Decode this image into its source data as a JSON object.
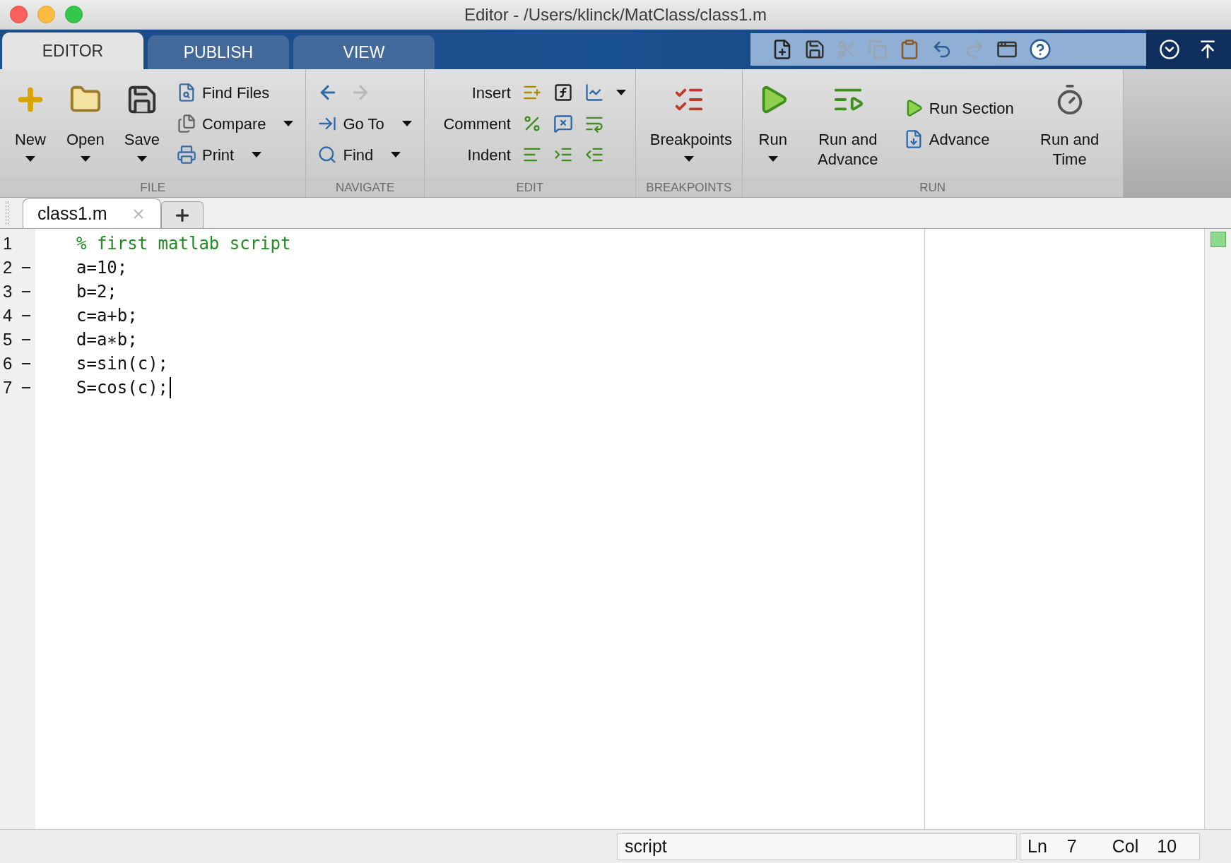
{
  "window": {
    "title": "Editor - /Users/klinck/MatClass/class1.m"
  },
  "ribbon": {
    "tabs": [
      {
        "label": "EDITOR",
        "selected": true
      },
      {
        "label": "PUBLISH",
        "selected": false
      },
      {
        "label": "VIEW",
        "selected": false
      }
    ],
    "groups": [
      {
        "label": "FILE",
        "buttons": [
          {
            "kind": "large",
            "label": "New",
            "menu": true
          },
          {
            "kind": "large",
            "label": "Open",
            "menu": true
          },
          {
            "kind": "large",
            "label": "Save",
            "menu": true
          },
          {
            "kind": "small",
            "label": "Find Files",
            "menu": false
          },
          {
            "kind": "small",
            "label": "Compare",
            "menu": true
          },
          {
            "kind": "small",
            "label": "Print",
            "menu": true
          }
        ]
      },
      {
        "label": "NAVIGATE",
        "buttons": [
          {
            "kind": "arrows"
          },
          {
            "kind": "small",
            "label": "Go To",
            "menu": true
          },
          {
            "kind": "small",
            "label": "Find",
            "menu": true
          }
        ]
      },
      {
        "label": "EDIT",
        "buttons": [
          {
            "kind": "row",
            "label": "Insert",
            "menu": true
          },
          {
            "kind": "row",
            "label": "Comment",
            "menu": false
          },
          {
            "kind": "row",
            "label": "Indent",
            "menu": false
          }
        ]
      },
      {
        "label": "BREAKPOINTS",
        "buttons": [
          {
            "kind": "large",
            "label": "Breakpoints",
            "menu": true
          }
        ]
      },
      {
        "label": "RUN",
        "buttons": [
          {
            "kind": "large",
            "label": "Run",
            "menu": true
          },
          {
            "kind": "large",
            "label": "Run and Advance",
            "menu": false
          },
          {
            "kind": "small",
            "label": "Run Section",
            "menu": false
          },
          {
            "kind": "small",
            "label": "Advance",
            "menu": false
          },
          {
            "kind": "large",
            "label": "Run and Time",
            "menu": false
          }
        ]
      }
    ]
  },
  "documents": [
    {
      "label": "class1.m",
      "selected": true
    }
  ],
  "editor": {
    "lines": [
      {
        "number": "1",
        "text": "% first matlab script",
        "kind": "comment",
        "executable": false,
        "cursor": false
      },
      {
        "number": "2",
        "text": "a=10;",
        "kind": "code",
        "executable": true,
        "cursor": false
      },
      {
        "number": "3",
        "text": "b=2;",
        "kind": "code",
        "executable": true,
        "cursor": false
      },
      {
        "number": "4",
        "text": "c=a+b;",
        "kind": "code",
        "executable": true,
        "cursor": false
      },
      {
        "number": "5",
        "text": "d=a∗b;",
        "kind": "code",
        "executable": true,
        "cursor": false
      },
      {
        "number": "6",
        "text": "s=sin(c);",
        "kind": "code",
        "executable": true,
        "cursor": false
      },
      {
        "number": "7",
        "text": "S=cos(c);",
        "kind": "code",
        "executable": true,
        "cursor": true
      }
    ]
  },
  "status_bar": {
    "file_type": "script",
    "ln_label": "Ln",
    "ln": "7",
    "col_label": "Col",
    "col": "10"
  }
}
